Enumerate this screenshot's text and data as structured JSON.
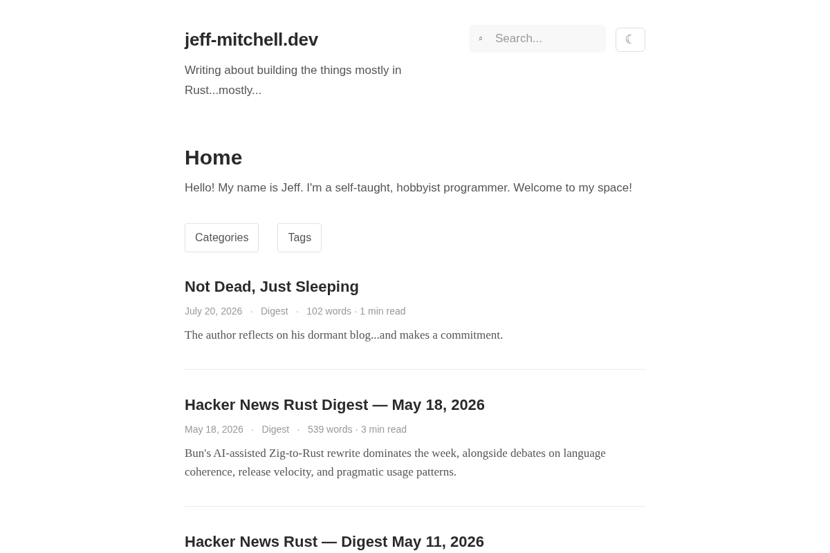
{
  "site": {
    "title": "jeff-mitchell.dev",
    "tagline": "Writing about building the things mostly in Rust...mostly..."
  },
  "search": {
    "icon": "⌕",
    "placeholder": "Search..."
  },
  "theme_toggle": {
    "icon": "☾"
  },
  "page": {
    "title": "Home",
    "intro": "Hello! My name is Jeff. I'm a self-taught, hobbyist programmer. Welcome to my space!"
  },
  "nav_buttons": [
    "Categories",
    "Tags"
  ],
  "posts": [
    {
      "title": "Not Dead, Just Sleeping",
      "meta": [
        "July 20, 2026",
        "·",
        "Digest",
        "·",
        "102 words · 1 min read"
      ],
      "summary": "The author reflects on his dormant blog...and makes a commitment."
    },
    {
      "title": "Hacker News Rust Digest — May 18, 2026",
      "meta": [
        "May 18, 2026",
        "·",
        "Digest",
        "·",
        "539 words · 3 min read"
      ],
      "summary": "Bun's AI-assisted Zig-to-Rust rewrite dominates the week, alongside debates on language coherence, release velocity, and pragmatic usage patterns."
    },
    {
      "title": "Hacker News Rust — Digest May 11, 2026"
    }
  ]
}
